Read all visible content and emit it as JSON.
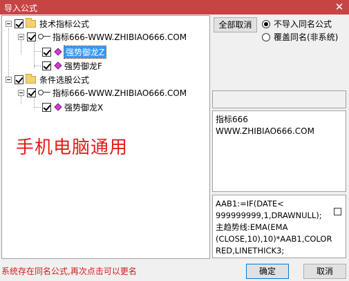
{
  "window": {
    "title": "导入公式",
    "close_glyph": "✕"
  },
  "tree": {
    "groups": [
      {
        "label": "技术指标公式",
        "formula": "指标666-WWW.ZHIBIAO666.COM",
        "items": [
          "强势御龙Z",
          "强势御龙F"
        ]
      },
      {
        "label": "条件选股公式",
        "formula": "指标666-WWW.ZHIBIAO666.COM",
        "items": [
          "强势御龙X"
        ]
      }
    ],
    "selected_item": "强势御龙Z"
  },
  "watermark": "手机电脑通用",
  "buttons": {
    "cancel_all": "全部取消",
    "ok": "确定",
    "cancel": "取消"
  },
  "options": {
    "no_import_same_name": "不导入同名公式",
    "overwrite_same_name": "覆盖同名(非系统)",
    "selected": "no_import_same_name"
  },
  "description": "指标666\nWWW.ZHIBIAO666.COM",
  "formula_code": "AAB1:=IF(DATE<\n999999999,1,DRAWNULL);\n主趋势线:EMA(EMA\n(CLOSE,10),10)*AAB1,COLOR\nRED,LINETHICK3;",
  "status_message": "系统存在同名公式,再次点击可以更名",
  "icons": {
    "folder": "folder-icon",
    "formula": "key-icon",
    "item": "diamond-icon",
    "close": "close-icon"
  },
  "colors": {
    "titlebar": "#c64444",
    "watermark": "#e41a1a",
    "status": "#d01c1c",
    "selection": "#3399ff",
    "item_icon": "#d23ed2"
  }
}
